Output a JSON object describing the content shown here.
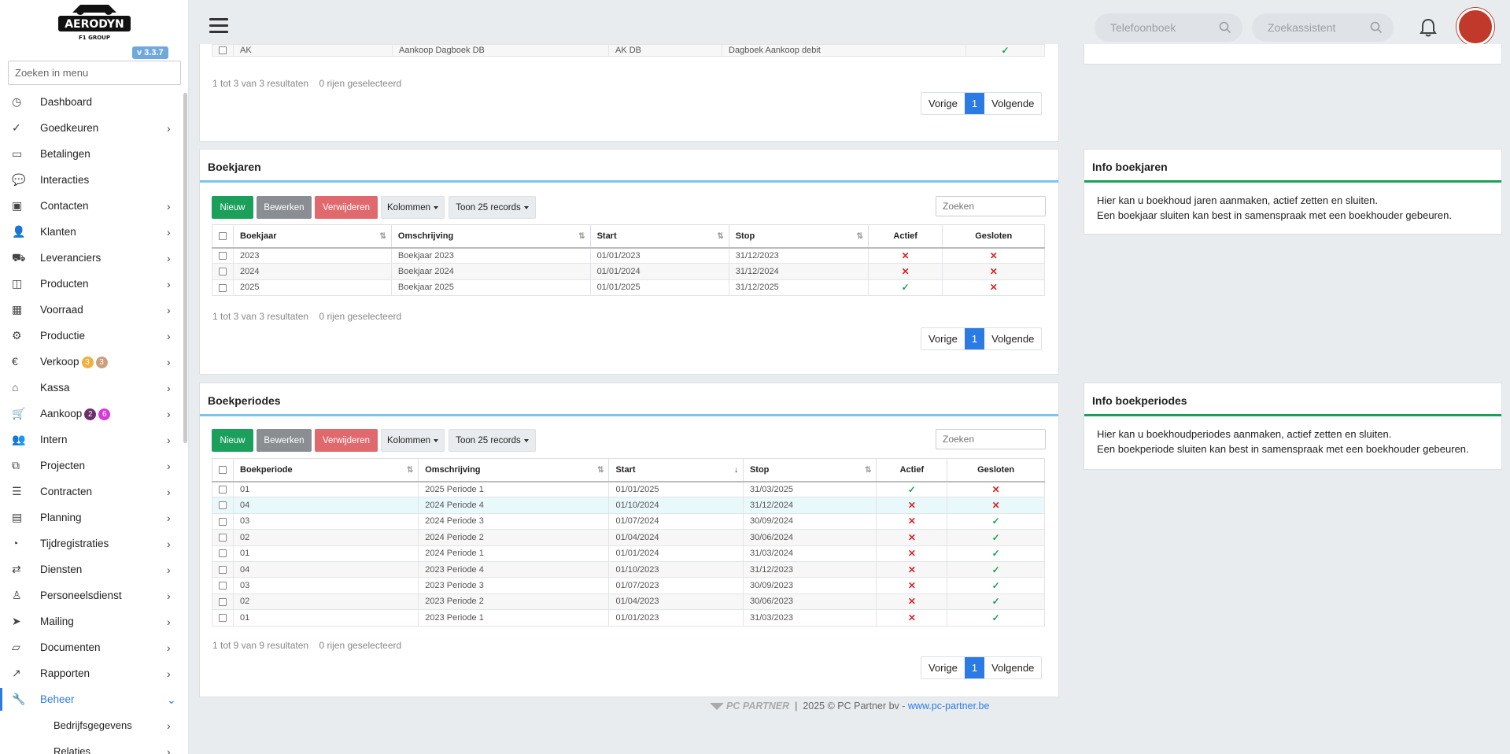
{
  "app": {
    "version": "v 3.3.7",
    "logo_text": "AERODYN",
    "logo_sub": "F1 GROUP"
  },
  "sidebar": {
    "search_placeholder": "Zoeken in menu",
    "items": [
      {
        "label": "Dashboard",
        "icon": "dashboard-icon",
        "chevron": false
      },
      {
        "label": "Goedkeuren",
        "icon": "approve-icon",
        "chevron": true
      },
      {
        "label": "Betalingen",
        "icon": "credit-card-icon",
        "chevron": false
      },
      {
        "label": "Interacties",
        "icon": "chat-icon",
        "chevron": false
      },
      {
        "label": "Contacten",
        "icon": "contact-card-icon",
        "chevron": true
      },
      {
        "label": "Klanten",
        "icon": "user-icon",
        "chevron": true
      },
      {
        "label": "Leveranciers",
        "icon": "truck-icon",
        "chevron": true
      },
      {
        "label": "Producten",
        "icon": "box-icon",
        "chevron": true
      },
      {
        "label": "Voorraad",
        "icon": "boxes-icon",
        "chevron": true
      },
      {
        "label": "Productie",
        "icon": "gears-icon",
        "chevron": true
      },
      {
        "label": "Verkoop",
        "icon": "euro-icon",
        "chevron": true,
        "badges": [
          {
            "text": "3",
            "color": "#c9a07b"
          },
          {
            "text": "3",
            "color": "#f0b040"
          }
        ]
      },
      {
        "label": "Kassa",
        "icon": "basket-icon",
        "chevron": true
      },
      {
        "label": "Aankoop",
        "icon": "cart-icon",
        "chevron": true,
        "badges": [
          {
            "text": "6",
            "color": "#d63ad6"
          },
          {
            "text": "2",
            "color": "#6b2f6b"
          }
        ]
      },
      {
        "label": "Intern",
        "icon": "users-icon",
        "chevron": true
      },
      {
        "label": "Projecten",
        "icon": "project-icon",
        "chevron": true
      },
      {
        "label": "Contracten",
        "icon": "contract-icon",
        "chevron": true
      },
      {
        "label": "Planning",
        "icon": "calendar-icon",
        "chevron": true
      },
      {
        "label": "Tijdregistraties",
        "icon": "clock-icon",
        "chevron": true
      },
      {
        "label": "Diensten",
        "icon": "repeat-icon",
        "chevron": true
      },
      {
        "label": "Personeelsdienst",
        "icon": "person-icon",
        "chevron": true
      },
      {
        "label": "Mailing",
        "icon": "send-icon",
        "chevron": true
      },
      {
        "label": "Documenten",
        "icon": "folder-icon",
        "chevron": true
      },
      {
        "label": "Rapporten",
        "icon": "chart-line-icon",
        "chevron": true
      },
      {
        "label": "Beheer",
        "icon": "wrench-icon",
        "chevron": true,
        "active": true
      },
      {
        "label": "Bedrijfsgegevens",
        "icon": "",
        "chevron": true,
        "sub": true
      },
      {
        "label": "Relaties",
        "icon": "",
        "chevron": true,
        "sub": true
      }
    ]
  },
  "topbar": {
    "phonebook_placeholder": "Telefoonboek",
    "assistant_placeholder": "Zoekassistent"
  },
  "top_table": {
    "row": [
      "AK",
      "Aankoop Dagboek DB",
      "AK DB",
      "Dagboek Aankoop debit"
    ],
    "info": "1 tot 3 van 3 resultaten",
    "selected": "0 rijen geselecteerd"
  },
  "pager": {
    "prev": "Vorige",
    "page": "1",
    "next": "Volgende"
  },
  "buttons": {
    "new": "Nieuw",
    "edit": "Bewerken",
    "delete": "Verwijderen",
    "columns": "Kolommen",
    "show": "Toon 25 records",
    "search_placeholder": "Zoeken"
  },
  "boekjaren": {
    "title": "Boekjaren",
    "columns": [
      "Boekjaar",
      "Omschrijving",
      "Start",
      "Stop",
      "Actief",
      "Gesloten"
    ],
    "rows": [
      [
        "2023",
        "Boekjaar 2023",
        "01/01/2023",
        "31/12/2023",
        "no",
        "no"
      ],
      [
        "2024",
        "Boekjaar 2024",
        "01/01/2024",
        "31/12/2024",
        "no",
        "no"
      ],
      [
        "2025",
        "Boekjaar 2025",
        "01/01/2025",
        "31/12/2025",
        "yes",
        "no"
      ]
    ],
    "info": "1 tot 3 van 3 resultaten",
    "selected": "0 rijen geselecteerd"
  },
  "info_boekjaren": {
    "title": "Info boekjaren",
    "line1": "Hier kan u boekhoud jaren aanmaken, actief zetten en sluiten.",
    "line2": "Een boekjaar sluiten kan best in samenspraak met een boekhouder gebeuren."
  },
  "boekperiodes": {
    "title": "Boekperiodes",
    "columns": [
      "Boekperiode",
      "Omschrijving",
      "Start",
      "Stop",
      "Actief",
      "Gesloten"
    ],
    "rows": [
      [
        "01",
        "2025 Periode 1",
        "01/01/2025",
        "31/03/2025",
        "yes",
        "no"
      ],
      [
        "04",
        "2024 Periode 4",
        "01/10/2024",
        "31/12/2024",
        "no",
        "no"
      ],
      [
        "03",
        "2024 Periode 3",
        "01/07/2024",
        "30/09/2024",
        "no",
        "yes"
      ],
      [
        "02",
        "2024 Periode 2",
        "01/04/2024",
        "30/06/2024",
        "no",
        "yes"
      ],
      [
        "01",
        "2024 Periode 1",
        "01/01/2024",
        "31/03/2024",
        "no",
        "yes"
      ],
      [
        "04",
        "2023 Periode 4",
        "01/10/2023",
        "31/12/2023",
        "no",
        "yes"
      ],
      [
        "03",
        "2023 Periode 3",
        "01/07/2023",
        "30/09/2023",
        "no",
        "yes"
      ],
      [
        "02",
        "2023 Periode 2",
        "01/04/2023",
        "30/06/2023",
        "no",
        "yes"
      ],
      [
        "01",
        "2023 Periode 1",
        "01/01/2023",
        "31/03/2023",
        "no",
        "yes"
      ]
    ],
    "info": "1 tot 9 van 9 resultaten",
    "selected": "0 rijen geselecteerd"
  },
  "info_boekperiodes": {
    "title": "Info boekperiodes",
    "line1": "Hier kan u boekhoudperiodes aanmaken, actief zetten en sluiten.",
    "line2": "Een boekperiode sluiten kan best in samenspraak met een boekhouder gebeuren."
  },
  "footer": {
    "brand": "PC PARTNER",
    "sep": "|",
    "copy": "2025 © PC Partner bv - ",
    "link": "www.pc-partner.be"
  }
}
